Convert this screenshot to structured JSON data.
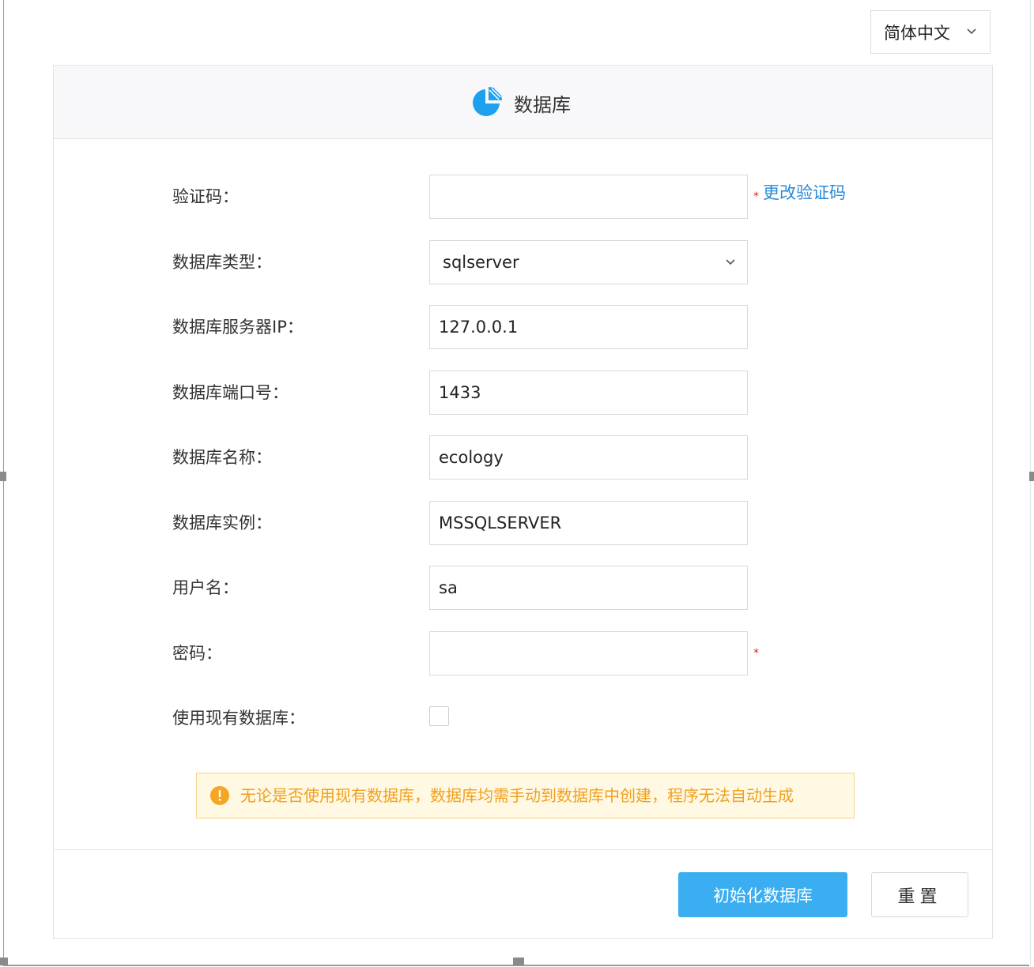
{
  "language_select": {
    "value": "简体中文"
  },
  "card": {
    "title": "数据库"
  },
  "form": {
    "captcha": {
      "label": "验证码：",
      "value": "",
      "required_mark": "*",
      "change_link": "更改验证码"
    },
    "db_type": {
      "label": "数据库类型：",
      "value": "sqlserver"
    },
    "server_ip": {
      "label": "数据库服务器IP：",
      "value": "127.0.0.1"
    },
    "port": {
      "label": "数据库端口号：",
      "value": "1433"
    },
    "db_name": {
      "label": "数据库名称：",
      "value": "ecology"
    },
    "instance": {
      "label": "数据库实例：",
      "value": "MSSQLSERVER"
    },
    "username": {
      "label": "用户名：",
      "value": "sa"
    },
    "password": {
      "label": "密码：",
      "value": "",
      "required_mark": "*"
    },
    "use_existing": {
      "label": "使用现有数据库：",
      "checked": false
    }
  },
  "notice": {
    "text": "无论是否使用现有数据库，数据库均需手动到数据库中创建，程序无法自动生成"
  },
  "buttons": {
    "init": "初始化数据库",
    "reset": "重置"
  },
  "colors": {
    "primary": "#3aaef0",
    "link": "#2a8ad8",
    "warning": "#f0a020",
    "required": "#e02020"
  }
}
